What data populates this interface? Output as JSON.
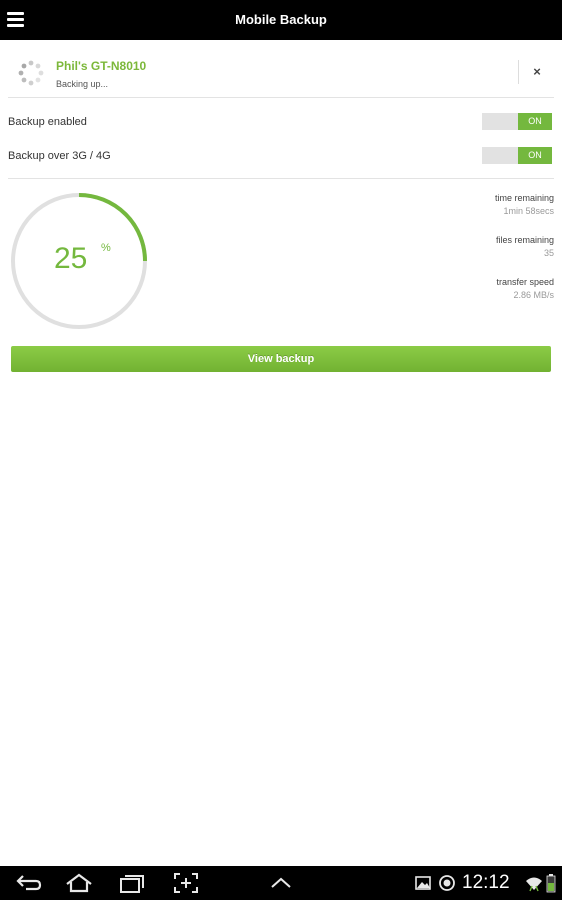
{
  "app": {
    "title": "Mobile Backup"
  },
  "device": {
    "name": "Phil's GT-N8010",
    "status": "Backing up...",
    "close_label": "×"
  },
  "settings": [
    {
      "label": "Backup enabled",
      "toggle": "ON"
    },
    {
      "label": "Backup over 3G / 4G",
      "toggle": "ON"
    }
  ],
  "progress": {
    "percent": 25,
    "display": "25",
    "sign": "%"
  },
  "stats": [
    {
      "label": "time remaining",
      "value": "1min 58secs"
    },
    {
      "label": "files remaining",
      "value": "35"
    },
    {
      "label": "transfer speed",
      "value": "2.86 MB/s"
    }
  ],
  "actions": {
    "view_backup": "View backup"
  },
  "status_bar": {
    "time": "12:12"
  },
  "colors": {
    "accent": "#74b83e",
    "track": "#e0e0e0",
    "bar": "#000000"
  },
  "icons": [
    "menu-icon",
    "spinner-icon",
    "close-icon",
    "back-icon",
    "home-icon",
    "recent-apps-icon",
    "screenshot-icon",
    "up-arrow-icon",
    "gallery-icon",
    "sync-icon",
    "wifi-icon",
    "battery-icon"
  ]
}
